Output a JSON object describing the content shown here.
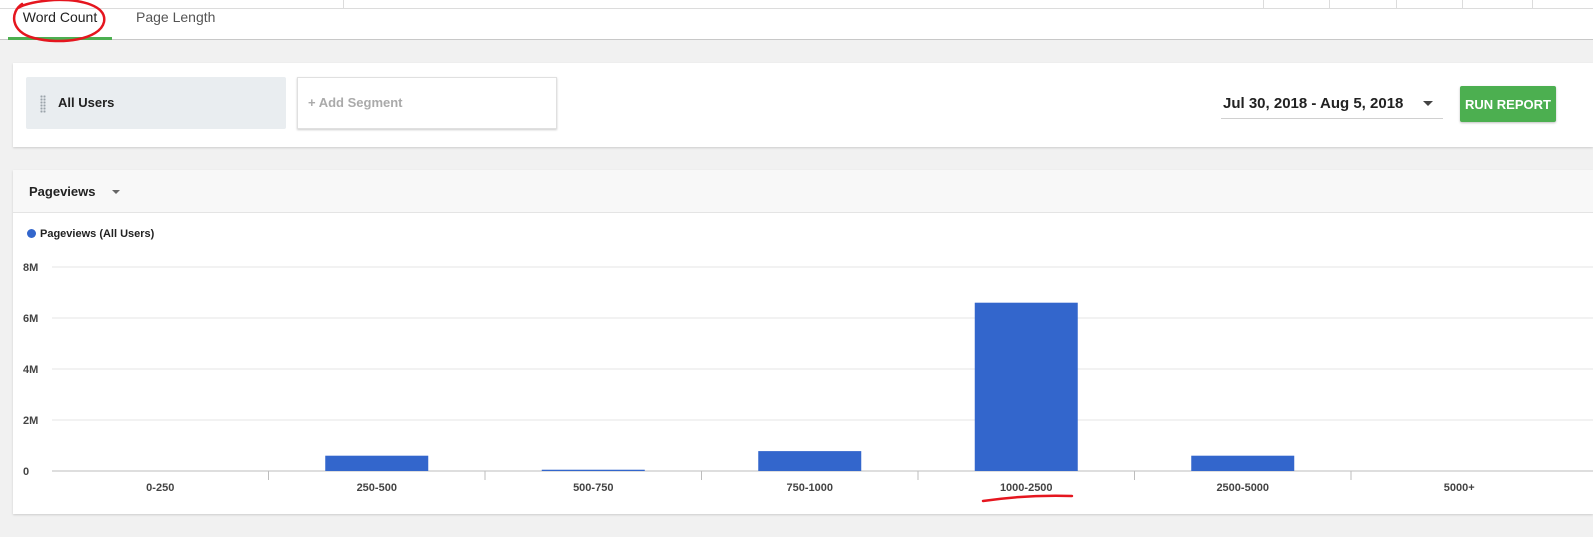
{
  "tabs": [
    {
      "label": "Word Count",
      "active": true
    },
    {
      "label": "Page Length",
      "active": false
    }
  ],
  "segments": {
    "selected": "All Users",
    "add_label": "+ Add Segment"
  },
  "date_range": "Jul 30, 2018 - Aug 5, 2018",
  "run_report_label": "RUN REPORT",
  "metric_selector": "Pageviews",
  "colors": {
    "accent_green": "#4caf50",
    "series_blue": "#3366cc",
    "annotation_red": "#e5161f"
  },
  "chart_data": {
    "type": "bar",
    "categories": [
      "0-250",
      "250-500",
      "500-750",
      "750-1000",
      "1000-2500",
      "2500-5000",
      "5000+"
    ],
    "series": [
      {
        "name": "Pageviews (All Users)",
        "values": [
          0,
          600000,
          50000,
          780000,
          6600000,
          600000,
          0
        ]
      }
    ],
    "y_ticks": [
      "0",
      "2M",
      "4M",
      "6M",
      "8M"
    ],
    "ylim": [
      0,
      8000000
    ],
    "grid": true,
    "legend": "top-left"
  }
}
